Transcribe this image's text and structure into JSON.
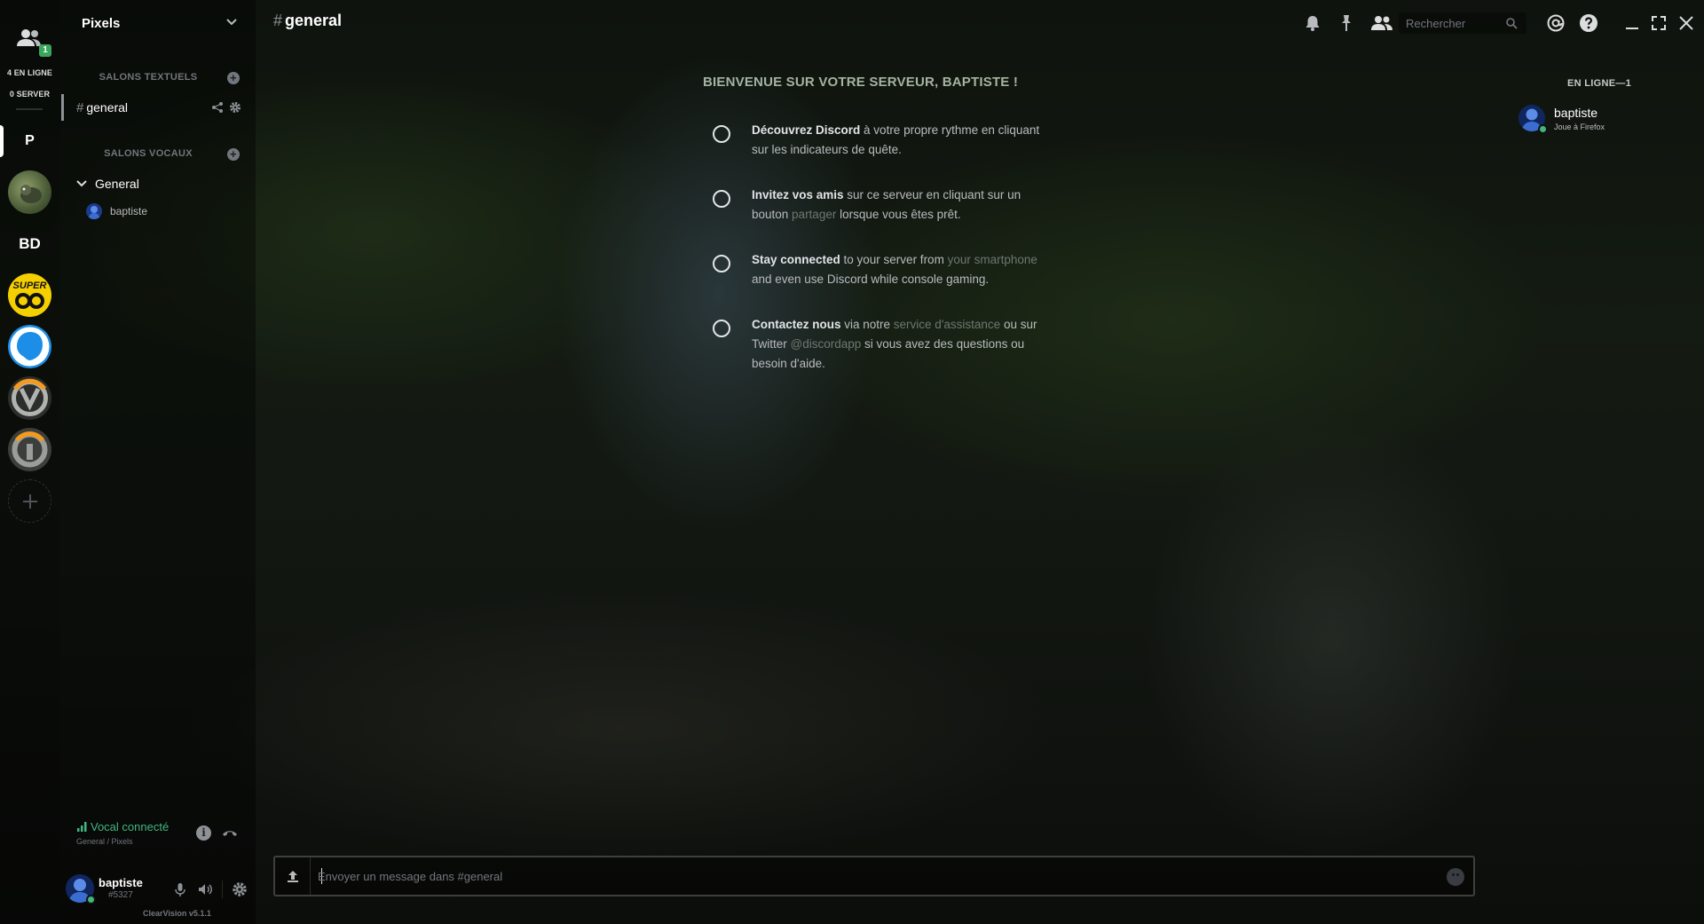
{
  "window": {
    "minimize_icon": "minimize-icon",
    "maximize_icon": "maximize-icon",
    "close_icon": "close-icon"
  },
  "server_rail": {
    "friends_badge": "1",
    "online_count": "4 EN LIGNE",
    "server_count": "0 SERVER",
    "servers": [
      {
        "id": "pixels",
        "label": "P",
        "active": true
      },
      {
        "id": "avatar-server",
        "label": ""
      },
      {
        "id": "bd",
        "label": "BD"
      },
      {
        "id": "super8",
        "label": "SUPER"
      },
      {
        "id": "blue-server",
        "label": ""
      },
      {
        "id": "overwatch-1",
        "label": ""
      },
      {
        "id": "overwatch-2",
        "label": ""
      }
    ],
    "add_server_icon": "plus-icon"
  },
  "guild": {
    "name": "Pixels",
    "text_category": "SALONS TEXTUELS",
    "voice_category": "SALONS VOCAUX",
    "text_channel": "general",
    "hash": "#",
    "voice_channel": "General",
    "voice_user": "baptiste"
  },
  "voice_status": {
    "title": "Vocal connecté",
    "subtitle": "General / Pixels",
    "info_glyph": "i"
  },
  "user": {
    "name": "baptiste",
    "tag": "#5327",
    "version": "ClearVision v5.1.1"
  },
  "header": {
    "hash": "#",
    "channel": "general",
    "search_placeholder": "Rechercher"
  },
  "welcome": {
    "title": "BIENVENUE SUR VOTRE SERVEUR, BAPTISTE !",
    "quests": [
      {
        "bold": "Découvrez Discord",
        "t1": " à votre propre rythme en cliquant sur les indicateurs de quête.",
        "link": "",
        "t2": "",
        "link2": "",
        "t3": ""
      },
      {
        "bold": "Invitez vos amis",
        "t1": " sur ce serveur en cliquant sur un bouton ",
        "link": "partager",
        "t2": " lorsque vous êtes prêt.",
        "link2": "",
        "t3": ""
      },
      {
        "bold": "Stay connected",
        "t1": " to your server from ",
        "link": "your smartphone",
        "t2": " and even use Discord while console gaming.",
        "link2": "",
        "t3": ""
      },
      {
        "bold": "Contactez nous",
        "t1": " via notre ",
        "link": "service d'assistance",
        "t2": " ou sur Twitter ",
        "link2": "@discordapp",
        "t3": " si vous avez des questions ou besoin d'aide."
      }
    ]
  },
  "members": {
    "header": "EN LIGNE—1",
    "list": [
      {
        "name": "baptiste",
        "activity": "Joue à Firefox"
      }
    ]
  },
  "composer": {
    "placeholder": "Envoyer un message dans #general"
  },
  "colors": {
    "online": "#43b581",
    "welcome_title": "#a5b3a1"
  }
}
